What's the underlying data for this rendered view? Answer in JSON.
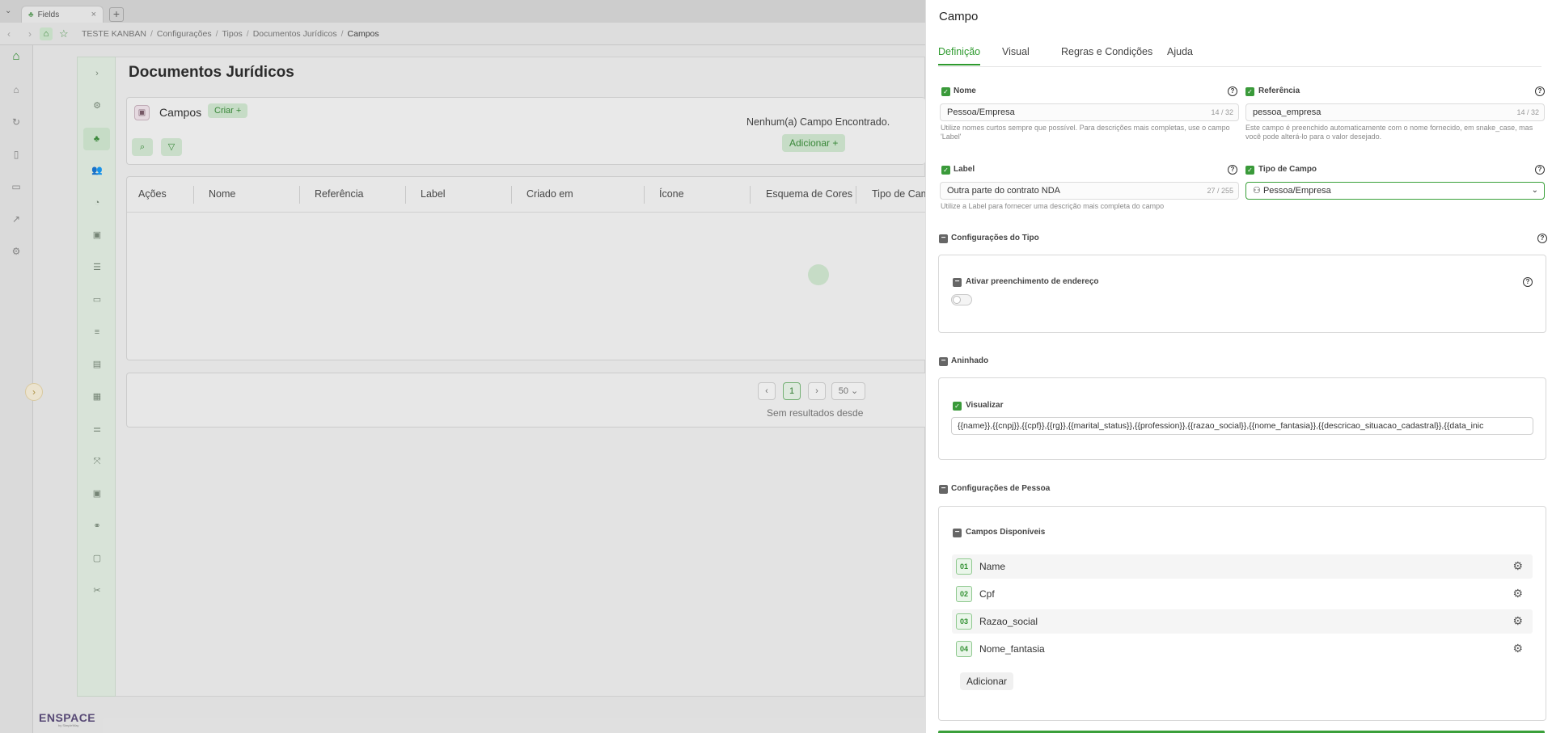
{
  "browser": {
    "tab_title": "Fields",
    "tab_icon": "leaf-icon",
    "new_tab": "+",
    "breadcrumb": [
      "TESTE KANBAN",
      "Configurações",
      "Tipos",
      "Documentos Jurídicos",
      "Campos"
    ]
  },
  "app": {
    "page_title": "Documentos Jurídicos",
    "logo": "ENSPACE",
    "logo_sub": "by SimpleWay",
    "fields_card": {
      "title": "Campos",
      "create_label": "Criar +"
    },
    "table": {
      "columns": [
        "Ações",
        "Nome",
        "Referência",
        "Label",
        "Criado em",
        "Ícone",
        "Esquema de Cores",
        "Tipo de Cam"
      ],
      "empty_message": "Nenhum(a) Campo Encontrado.",
      "empty_add": "Adicionar +"
    },
    "pagination": {
      "prev": "‹",
      "current": "1",
      "next": "›",
      "page_size": "50",
      "note": "Sem resultados desde"
    }
  },
  "panel": {
    "title": "Campo",
    "tabs": [
      "Definição",
      "Visual",
      "Regras e Condições",
      "Ajuda"
    ],
    "active_tab": "Definição",
    "nome": {
      "label": "Nome",
      "value": "Pessoa/Empresa",
      "count": "14 / 32",
      "hint": "Utilize nomes curtos sempre que possível. Para descrições mais completas, use o campo 'Label'"
    },
    "referencia": {
      "label": "Referência",
      "value": "pessoa_empresa",
      "count": "14 / 32",
      "hint": "Este campo é preenchido automaticamente com o nome fornecido, em snake_case, mas você pode alterá-lo para o valor desejado."
    },
    "label_field": {
      "label": "Label",
      "value": "Outra parte do contrato NDA",
      "count": "27 / 255",
      "hint": "Utilize a Label para fornecer uma descrição mais completa do campo"
    },
    "tipo_campo": {
      "label": "Tipo de Campo",
      "value": "Pessoa/Empresa",
      "icon": "person-icon"
    },
    "config_tipo": {
      "title": "Configurações do Tipo",
      "address_autofill": {
        "label": "Ativar preenchimento de endereço",
        "enabled": false
      }
    },
    "aninhado": {
      "title": "Aninhado",
      "visualizar": {
        "label": "Visualizar",
        "value": "{{name}},{{cnpj}},{{cpf}},{{rg}},{{marital_status}},{{profession}},{{razao_social}},{{nome_fantasia}},{{descricao_situacao_cadastral}},{{data_inic"
      }
    },
    "config_pessoa": {
      "title": "Configurações de Pessoa",
      "available_fields": {
        "title": "Campos Disponíveis",
        "items": [
          {
            "num": "01",
            "name": "Name"
          },
          {
            "num": "02",
            "name": "Cpf"
          },
          {
            "num": "03",
            "name": "Razao_social"
          },
          {
            "num": "04",
            "name": "Nome_fantasia"
          }
        ],
        "add_label": "Adicionar"
      }
    }
  },
  "colors": {
    "accent": "#2e9a2e",
    "accent_light": "#cfe5cf"
  }
}
